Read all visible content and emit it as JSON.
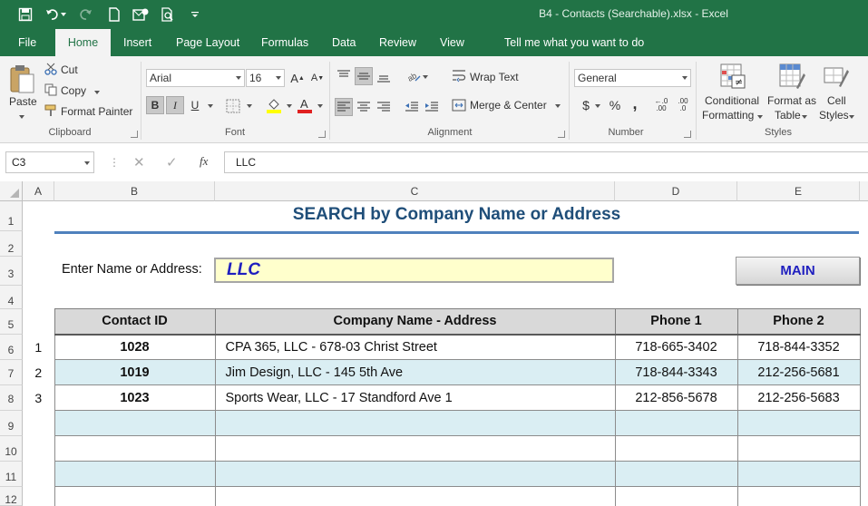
{
  "window": {
    "title": "B4 - Contacts (Searchable).xlsx - Excel"
  },
  "tabs": [
    {
      "label": "File"
    },
    {
      "label": "Home"
    },
    {
      "label": "Insert"
    },
    {
      "label": "Page Layout"
    },
    {
      "label": "Formulas"
    },
    {
      "label": "Data"
    },
    {
      "label": "Review"
    },
    {
      "label": "View"
    },
    {
      "label": "Tell me what you want to do"
    }
  ],
  "ribbon": {
    "clipboard": {
      "paste": "Paste",
      "cut": "Cut",
      "copy": "Copy",
      "format_painter": "Format Painter",
      "group": "Clipboard"
    },
    "font": {
      "name": "Arial",
      "size": "16",
      "bold": "B",
      "italic": "I",
      "underline": "U",
      "grow": "A",
      "shrink": "A",
      "group": "Font"
    },
    "alignment": {
      "wrap_text": "Wrap Text",
      "merge_center": "Merge & Center",
      "group": "Alignment"
    },
    "number": {
      "format": "General",
      "currency": "$",
      "percent": "%",
      "comma": ",",
      "inc_decimal": ".00",
      "dec_decimal": ".0",
      "group": "Number"
    },
    "styles": {
      "conditional_1": "Conditional",
      "conditional_2": "Formatting",
      "format_table_1": "Format as",
      "format_table_2": "Table",
      "cell_styles_1": "Cell",
      "cell_styles_2": "Styles",
      "group": "Styles"
    }
  },
  "formula_bar": {
    "name_box": "C3",
    "fx": "fx",
    "value": "LLC"
  },
  "columns": [
    "A",
    "B",
    "C",
    "D",
    "E"
  ],
  "rows": [
    "1",
    "2",
    "3",
    "4",
    "5",
    "6",
    "7",
    "8",
    "9",
    "10",
    "11",
    "12"
  ],
  "sheet": {
    "title": "SEARCH by Company Name or Address",
    "search_label": "Enter Name or Address:",
    "search_value": "LLC",
    "main_button": "MAIN",
    "headers": {
      "contact_id": "Contact ID",
      "company": "Company Name - Address",
      "phone1": "Phone 1",
      "phone2": "Phone 2"
    },
    "results": [
      {
        "n": "1",
        "id": "1028",
        "company": "CPA 365, LLC - 678-03 Christ Street",
        "phone1": "718-665-3402",
        "phone2": "718-844-3352"
      },
      {
        "n": "2",
        "id": "1019",
        "company": "Jim Design, LLC - 145 5th Ave",
        "phone1": "718-844-3343",
        "phone2": "212-256-5681"
      },
      {
        "n": "3",
        "id": "1023",
        "company": "Sports Wear, LLC - 17 Standford Ave 1",
        "phone1": "212-856-5678",
        "phone2": "212-256-5683"
      }
    ]
  },
  "colors": {
    "excel_green": "#217346",
    "title_blue": "#1f4e79",
    "search_fill": "#ffffcc",
    "band_fill": "#daeef3"
  }
}
